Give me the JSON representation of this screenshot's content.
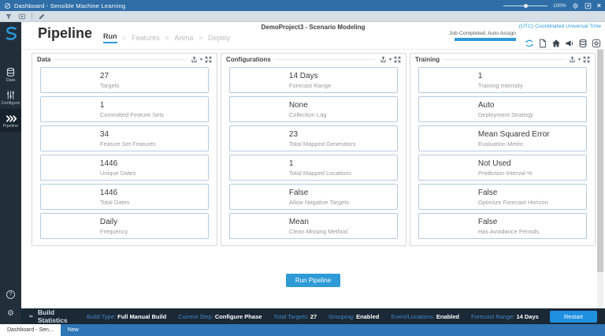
{
  "titlebar": {
    "title": "Dashboard - Sensible Machine Learning",
    "zoom_level": "100%"
  },
  "toolbar": {
    "icons": [
      "filter-icon",
      "snapshot-icon",
      "edit-icon"
    ]
  },
  "sidebar": {
    "nav": [
      {
        "label": "Data",
        "icon": "database-icon",
        "active": false
      },
      {
        "label": "Configure",
        "icon": "sliders-icon",
        "active": false
      },
      {
        "label": "Pipeline",
        "icon": "chevrons-icon",
        "active": true
      }
    ],
    "help_glyph": "?",
    "gear_glyph": "⚙"
  },
  "header": {
    "page_title": "Pipeline",
    "breadcrumb": [
      {
        "label": "Run",
        "active": true
      },
      {
        "label": "Features",
        "active": false
      },
      {
        "label": "Arena",
        "active": false
      },
      {
        "label": "Deploy",
        "active": false
      }
    ],
    "project_title": "DemoProject3 - Scenario Modeling",
    "timezone": "(UTC) Coordinated Universal Time",
    "job_status": "Job Completed: Auto Assign",
    "job_progress_pct": 100,
    "icons": [
      "sync-icon",
      "document-icon",
      "home-icon",
      "announcement-icon",
      "database-icon",
      "data-source-icon"
    ]
  },
  "panels": [
    {
      "title": "Data",
      "cards": [
        {
          "value": "27",
          "label": "Targets"
        },
        {
          "value": "1",
          "label": "Committed Feature Sets"
        },
        {
          "value": "34",
          "label": "Feature Set Features"
        },
        {
          "value": "1446",
          "label": "Unique Dates"
        },
        {
          "value": "1446",
          "label": "Total Dates"
        },
        {
          "value": "Daily",
          "label": "Frequency"
        }
      ]
    },
    {
      "title": "Configurations",
      "cards": [
        {
          "value": "14 Days",
          "label": "Forecast Range"
        },
        {
          "value": "None",
          "label": "Collection Lag"
        },
        {
          "value": "23",
          "label": "Total Mapped Generators"
        },
        {
          "value": "1",
          "label": "Total Mapped Locations"
        },
        {
          "value": "False",
          "label": "Allow Negative Targets"
        },
        {
          "value": "Mean",
          "label": "Clean Missing Method"
        }
      ]
    },
    {
      "title": "Training",
      "cards": [
        {
          "value": "1",
          "label": "Training Intensity"
        },
        {
          "value": "Auto",
          "label": "Deployment Strategy"
        },
        {
          "value": "Mean Squared Error",
          "label": "Evaluation Metric"
        },
        {
          "value": "Not Used",
          "label": "Prediction Interval %"
        },
        {
          "value": "False",
          "label": "Optimize Forecast Horizon"
        },
        {
          "value": "False",
          "label": "Has Avoidance Periods"
        }
      ]
    }
  ],
  "actions": {
    "run_pipeline": "Run Pipeline",
    "restart": "Restart"
  },
  "status_bar": {
    "title": "Build Statistics",
    "stats": [
      {
        "label": "Build Type:",
        "value": "Full Manual Build"
      },
      {
        "label": "Current Step:",
        "value": "Configure Phase"
      },
      {
        "label": "Total Targets:",
        "value": "27"
      },
      {
        "label": "Grouping:",
        "value": "Enabled"
      },
      {
        "label": "Event/Locations:",
        "value": "Enabled"
      },
      {
        "label": "Forecast Range:",
        "value": "14 Days"
      }
    ]
  },
  "taskbar": {
    "tabs": [
      {
        "label": "Dashboard - Sen...",
        "active": true
      },
      {
        "label": "New",
        "active": false
      }
    ]
  },
  "colors": {
    "accent_blue": "#2d9cdb",
    "titlebar_blue": "#2f6ea7",
    "sidebar_navy": "#222f3b",
    "status_navy": "#1b2835",
    "taskbar_blue": "#2e76b8",
    "card_border": "#b5cbe0",
    "button_blue": "#2e9bd6"
  }
}
